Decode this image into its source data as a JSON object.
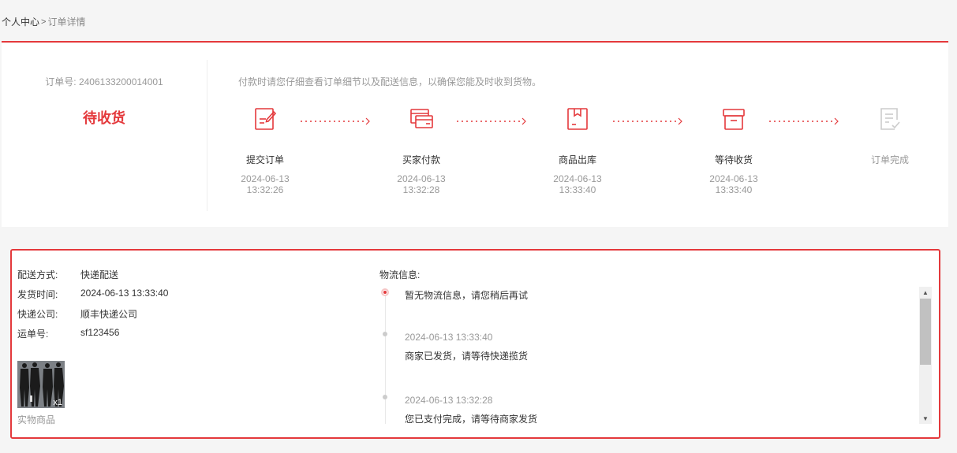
{
  "breadcrumb": {
    "home": "个人中心",
    "separator": ">",
    "current": "订单详情"
  },
  "order": {
    "number_label": "订单号:",
    "number": "2406133200014001",
    "status": "待收货",
    "tip": "付款时请您仔细查看订单细节以及配送信息，以确保您能及时收到货物。"
  },
  "steps": [
    {
      "label": "提交订单",
      "date": "2024-06-13",
      "time": "13:32:26",
      "icon": "edit-document-icon",
      "done": true
    },
    {
      "label": "买家付款",
      "date": "2024-06-13",
      "time": "13:32:28",
      "icon": "payment-card-icon",
      "done": true
    },
    {
      "label": "商品出库",
      "date": "2024-06-13",
      "time": "13:33:40",
      "icon": "package-out-icon",
      "done": true
    },
    {
      "label": "等待收货",
      "date": "2024-06-13",
      "time": "13:33:40",
      "icon": "box-receive-icon",
      "done": true
    },
    {
      "label": "订单完成",
      "date": "",
      "time": "",
      "icon": "order-complete-icon",
      "done": false
    }
  ],
  "shipping": {
    "method_label": "配送方式:",
    "method": "快递配送",
    "ship_time_label": "发货时间:",
    "ship_time": "2024-06-13 13:33:40",
    "company_label": "快递公司:",
    "company": "顺丰快递公司",
    "tracking_label": "运单号:",
    "tracking": "sf123456"
  },
  "product": {
    "qty": "x1",
    "type": "实物商品"
  },
  "logistics": {
    "title": "物流信息:",
    "entries": [
      {
        "time": "",
        "text": "暂无物流信息，请您稍后再试"
      },
      {
        "time": "2024-06-13 13:33:40",
        "text": "商家已发货，请等待快递揽货"
      },
      {
        "time": "2024-06-13 13:32:28",
        "text": "您已支付完成，请等待商家发货"
      }
    ]
  },
  "colors": {
    "accent": "#e4393c",
    "muted": "#999999",
    "pending_icon": "#cccccc"
  }
}
